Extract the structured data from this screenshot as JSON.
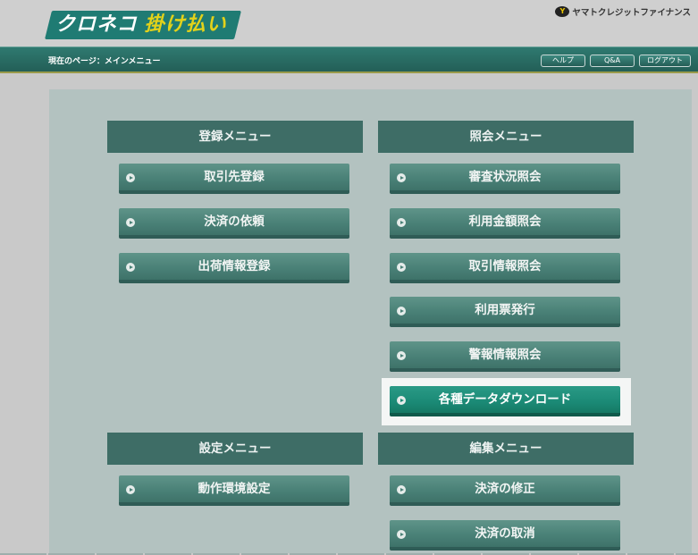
{
  "brand": {
    "logo_part1": "クロネコ",
    "logo_part2": "掛け払い",
    "company_icon": "Y",
    "company_name": "ヤマトクレジットファイナンス"
  },
  "navbar": {
    "breadcrumb": "現在のページ：メインメニュー",
    "buttons": [
      "ヘルプ",
      "Q&A",
      "ログアウト"
    ]
  },
  "sections": {
    "registration": {
      "title": "登録メニュー",
      "items": [
        "取引先登録",
        "決済の依頼",
        "出荷情報登録"
      ]
    },
    "inquiry": {
      "title": "照会メニュー",
      "items": [
        "審査状況照会",
        "利用金額照会",
        "取引情報照会",
        "利用票発行",
        "警報情報照会",
        "各種データダウンロード"
      ]
    },
    "settings": {
      "title": "設定メニュー",
      "items": [
        "動作環境設定"
      ]
    },
    "edit": {
      "title": "編集メニュー",
      "items": [
        "決済の修正",
        "決済の取消"
      ]
    }
  },
  "colors": {
    "header_teal": "#2f7a70",
    "section_header": "#3e6d66",
    "button": "#4a8177",
    "button_active": "#1b8a76",
    "logo_yellow": "#e3d21a"
  }
}
